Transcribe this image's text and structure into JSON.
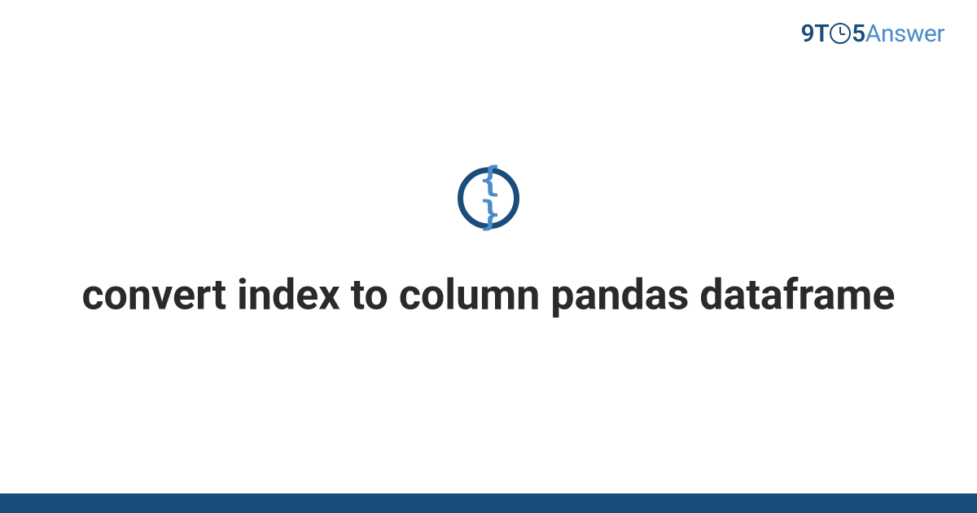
{
  "brand": {
    "nine": "9",
    "t": "T",
    "five": "5",
    "answer": "Answer"
  },
  "icon": {
    "braces": "{ }"
  },
  "title": "convert index to column pandas dataframe"
}
